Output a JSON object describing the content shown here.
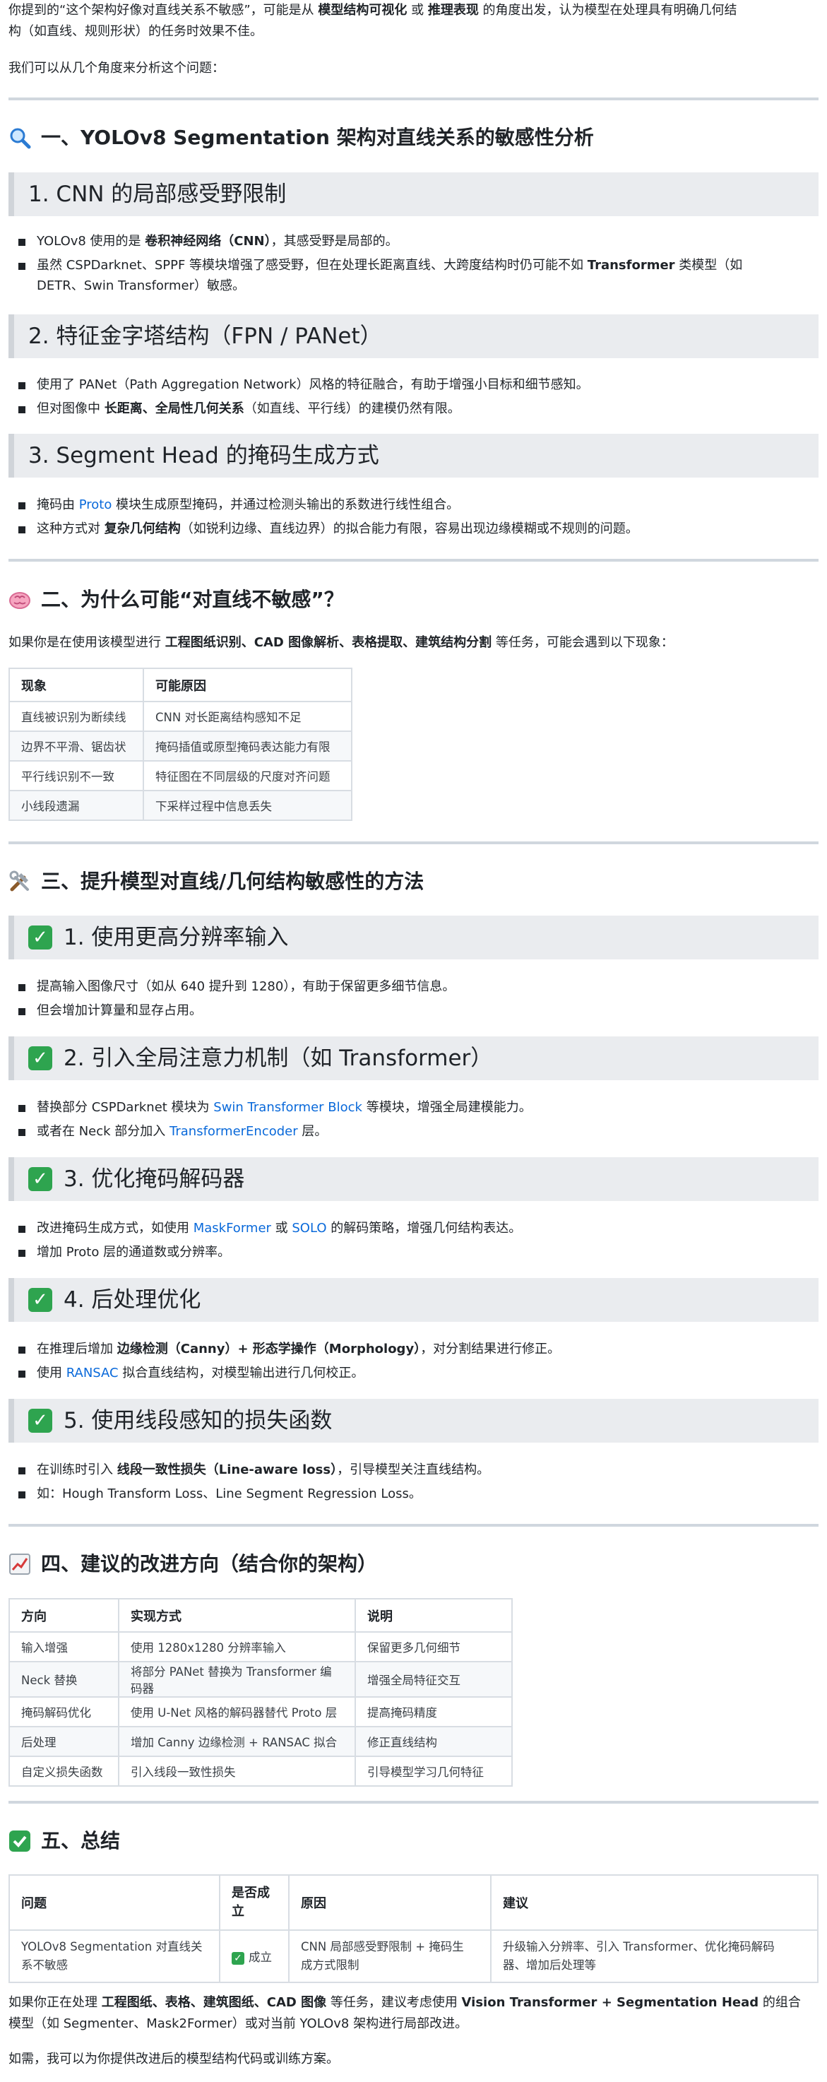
{
  "intro": {
    "line1_pre": "你提到的“这个架构好像对直线关系不敏感”，可能是从 ",
    "line1_b1": "模型结构可视化",
    "line1_mid": " 或 ",
    "line1_b2": "推理表现",
    "line1_post": " 的角度出发，认为模型在处理具有明确几何结",
    "line2": "构（如直线、规则形状）的任务时效果不佳。",
    "line3": "我们可以从几个角度来分析这个问题："
  },
  "section1": {
    "title": "一、YOLOv8 Segmentation 架构对直线关系的敏感性分析",
    "icon": "magnifier-icon",
    "sub1": {
      "title": "1. CNN 的局部感受野限制",
      "b1_pre": "YOLOv8 使用的是 ",
      "b1_b": "卷积神经网络（CNN）",
      "b1_post": "，其感受野是局部的。",
      "b2_pre": "虽然 CSPDarknet、SPPF 等模块增强了感受野，但在处理长距离直线、大跨度结构时仍可能不如 ",
      "b2_b": "Transformer",
      "b2_post": " 类模型（如",
      "b2_line2": "DETR、Swin Transformer）敏感。"
    },
    "sub2": {
      "title": "2. 特征金字塔结构（FPN / PANet）",
      "b1": "使用了 PANet（Path Aggregation Network）风格的特征融合，有助于增强小目标和细节感知。",
      "b2_pre": "但对图像中 ",
      "b2_b": "长距离、全局性几何关系",
      "b2_post": "（如直线、平行线）的建模仍然有限。"
    },
    "sub3": {
      "title": "3. Segment Head 的掩码生成方式",
      "b1_pre": "掩码由 ",
      "b1_link": "Proto",
      "b1_post": " 模块生成原型掩码，并通过检测头输出的系数进行线性组合。",
      "b2_pre": "这种方式对 ",
      "b2_b": "复杂几何结构",
      "b2_post": "（如锐利边缘、直线边界）的拟合能力有限，容易出现边缘模糊或不规则的问题。"
    }
  },
  "section2": {
    "title": "二、为什么可能“对直线不敏感”？",
    "icon": "brain-icon",
    "lead_pre": "如果你是在使用该模型进行 ",
    "lead_b": "工程图纸识别、CAD 图像解析、表格提取、建筑结构分割",
    "lead_post": " 等任务，可能会遇到以下现象：",
    "table": {
      "headers": [
        "现象",
        "可能原因"
      ],
      "rows": [
        [
          "直线被识别为断续线",
          "CNN 对长距离结构感知不足"
        ],
        [
          "边界不平滑、锯齿状",
          "掩码插值或原型掩码表达能力有限"
        ],
        [
          "平行线识别不一致",
          "特征图在不同层级的尺度对齐问题"
        ],
        [
          "小线段遗漏",
          "下采样过程中信息丢失"
        ]
      ]
    }
  },
  "section3": {
    "title": "三、提升模型对直线/几何结构敏感性的方法",
    "icon": "tools-icon",
    "sub1": {
      "title": "1. 使用更高分辨率输入",
      "b1": "提高输入图像尺寸（如从 640 提升到 1280），有助于保留更多细节信息。",
      "b2": "但会增加计算量和显存占用。"
    },
    "sub2": {
      "title": "2. 引入全局注意力机制（如 Transformer）",
      "b1_pre": "替换部分 CSPDarknet 模块为 ",
      "b1_link": "Swin Transformer Block",
      "b1_post": " 等模块，增强全局建模能力。",
      "b2_pre": "或者在 Neck 部分加入 ",
      "b2_link": "TransformerEncoder",
      "b2_post": " 层。"
    },
    "sub3": {
      "title": "3. 优化掩码解码器",
      "b1_pre": "改进掩码生成方式，如使用 ",
      "b1_link1": "MaskFormer",
      "b1_mid": " 或 ",
      "b1_link2": "SOLO",
      "b1_post": " 的解码策略，增强几何结构表达。",
      "b2": "增加 Proto 层的通道数或分辨率。"
    },
    "sub4": {
      "title": "4. 后处理优化",
      "b1_pre": "在推理后增加 ",
      "b1_b": "边缘检测（Canny）+ 形态学操作（Morphology）",
      "b1_post": "，对分割结果进行修正。",
      "b2_pre": "使用 ",
      "b2_link": "RANSAC",
      "b2_post": " 拟合直线结构，对模型输出进行几何校正。"
    },
    "sub5": {
      "title": "5. 使用线段感知的损失函数",
      "b1_pre": "在训练时引入 ",
      "b1_b": "线段一致性损失（Line-aware loss）",
      "b1_post": "，引导模型关注直线结构。",
      "b2": "如：Hough Transform Loss、Line Segment Regression Loss。"
    }
  },
  "section4": {
    "title": "四、建议的改进方向（结合你的架构）",
    "icon": "chart-up-icon",
    "table": {
      "headers": [
        "方向",
        "实现方式",
        "说明"
      ],
      "rows": [
        [
          "输入增强",
          "使用 1280x1280 分辨率输入",
          "保留更多几何细节"
        ],
        [
          "Neck 替换",
          "将部分 PANet 替换为 Transformer 编码器",
          "增强全局特征交互"
        ],
        [
          "掩码解码优化",
          "使用 U-Net 风格的解码器替代 Proto 层",
          "提高掩码精度"
        ],
        [
          "后处理",
          "增加 Canny 边缘检测 + RANSAC 拟合",
          "修正直线结构"
        ],
        [
          "自定义损失函数",
          "引入线段一致性损失",
          "引导模型学习几何特征"
        ]
      ]
    }
  },
  "section5": {
    "title": "五、总结",
    "icon": "check-icon",
    "table": {
      "headers": [
        "问题",
        "是否成立",
        "原因",
        "建议"
      ],
      "h2_line1": "是否成",
      "h2_line2": "立",
      "r_problem_1": "YOLOv8 Segmentation 对直线关",
      "r_problem_2": "系不敏感",
      "r_status": "成立",
      "r_reason_1": "CNN 局部感受野限制 + 掩码生",
      "r_reason_2": "成方式限制",
      "r_suggest_1": "升级输入分辨率、引入 Transformer、优化掩码解码",
      "r_suggest_2": "器、增加后处理等"
    },
    "closing_pre": "如果你正在处理 ",
    "closing_b": "工程图纸、表格、建筑图纸、CAD 图像",
    "closing_mid": " 等任务，建议考虑使用 ",
    "closing_b2": "Vision Transformer + Segmentation Head",
    "closing_post": " 的组合",
    "closing_line2": "模型（如 Segmenter、Mask2Former）或对当前 YOLOv8 架构进行局部改进。",
    "final": "如需，我可以为你提供改进后的模型结构代码或训练方案。"
  }
}
